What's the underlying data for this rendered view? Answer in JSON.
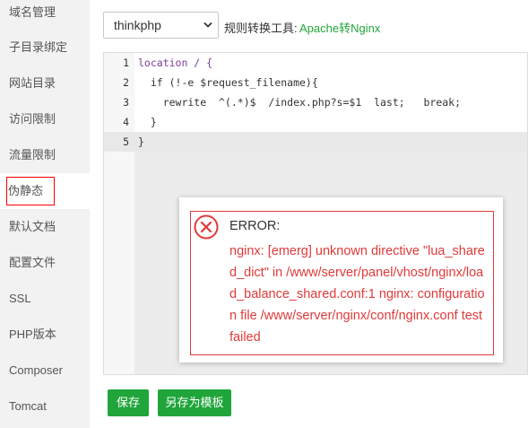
{
  "sidebar": {
    "items": [
      {
        "label": "域名管理"
      },
      {
        "label": "子目录绑定"
      },
      {
        "label": "网站目录"
      },
      {
        "label": "访问限制"
      },
      {
        "label": "流量限制"
      },
      {
        "label": "伪静态"
      },
      {
        "label": "默认文档"
      },
      {
        "label": "配置文件"
      },
      {
        "label": "SSL"
      },
      {
        "label": "PHP版本"
      },
      {
        "label": "Composer"
      },
      {
        "label": "Tomcat"
      }
    ],
    "active": "伪静态"
  },
  "toolbar": {
    "template_select": "thinkphp",
    "tool_label": "规则转换工具:",
    "tool_link": "Apache转Nginx"
  },
  "editor": {
    "line_numbers": [
      "1",
      "2",
      "3",
      "4",
      "5"
    ],
    "lines": [
      "location / {",
      "  if (!-e $request_filename){",
      "    rewrite  ^(.*)$  /index.php?s=$1  last;   break;",
      "  }",
      "}"
    ],
    "active_line": 5
  },
  "error": {
    "title": "ERROR:",
    "message": "nginx: [emerg] unknown directive \"lua_shared_dict\" in /www/server/panel/vhost/nginx/load_balance_shared.conf:1 nginx: configuration file /www/server/nginx/conf/nginx.conf test failed",
    "color": "#e03a3a"
  },
  "buttons": {
    "save": "保存",
    "save_as_template": "另存为模板"
  },
  "colors": {
    "accent": "#20a53a",
    "error": "#e03a3a"
  }
}
